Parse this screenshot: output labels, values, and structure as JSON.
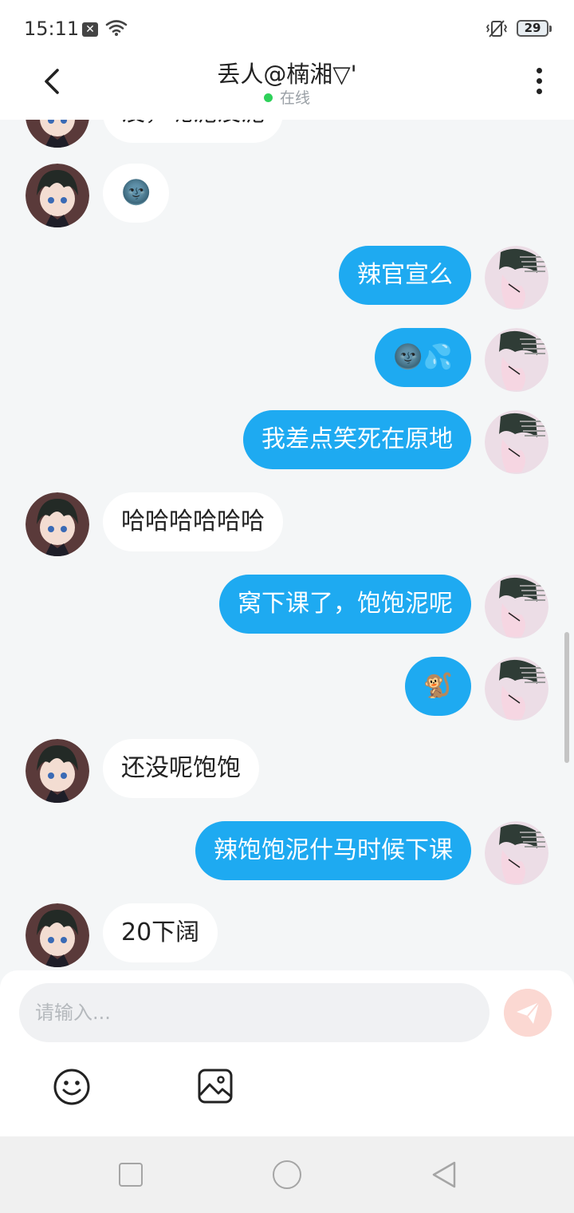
{
  "status_bar": {
    "time": "15:11",
    "battery": "29"
  },
  "header": {
    "title": "丢人@楠湘▽'",
    "status": "在线"
  },
  "messages": [
    {
      "side": "left",
      "text": "没，呢泥没泥"
    },
    {
      "side": "left",
      "text": "🌚"
    },
    {
      "side": "right",
      "text": "辣官宣么"
    },
    {
      "side": "right",
      "text": "🌚💦"
    },
    {
      "side": "right",
      "text": "我差点笑死在原地"
    },
    {
      "side": "left",
      "text": "哈哈哈哈哈哈"
    },
    {
      "side": "right",
      "text": "窝下课了，饱饱泥呢"
    },
    {
      "side": "right",
      "text": "🐒"
    },
    {
      "side": "left",
      "text": "还没呢饱饱"
    },
    {
      "side": "right",
      "text": "辣饱饱泥什马时候下课"
    },
    {
      "side": "left",
      "text": "20下阔"
    }
  ],
  "input": {
    "placeholder": "请输入..."
  },
  "colors": {
    "accent": "#1eaaf1",
    "send_button": "#f6a493",
    "online": "#2ed15a"
  }
}
